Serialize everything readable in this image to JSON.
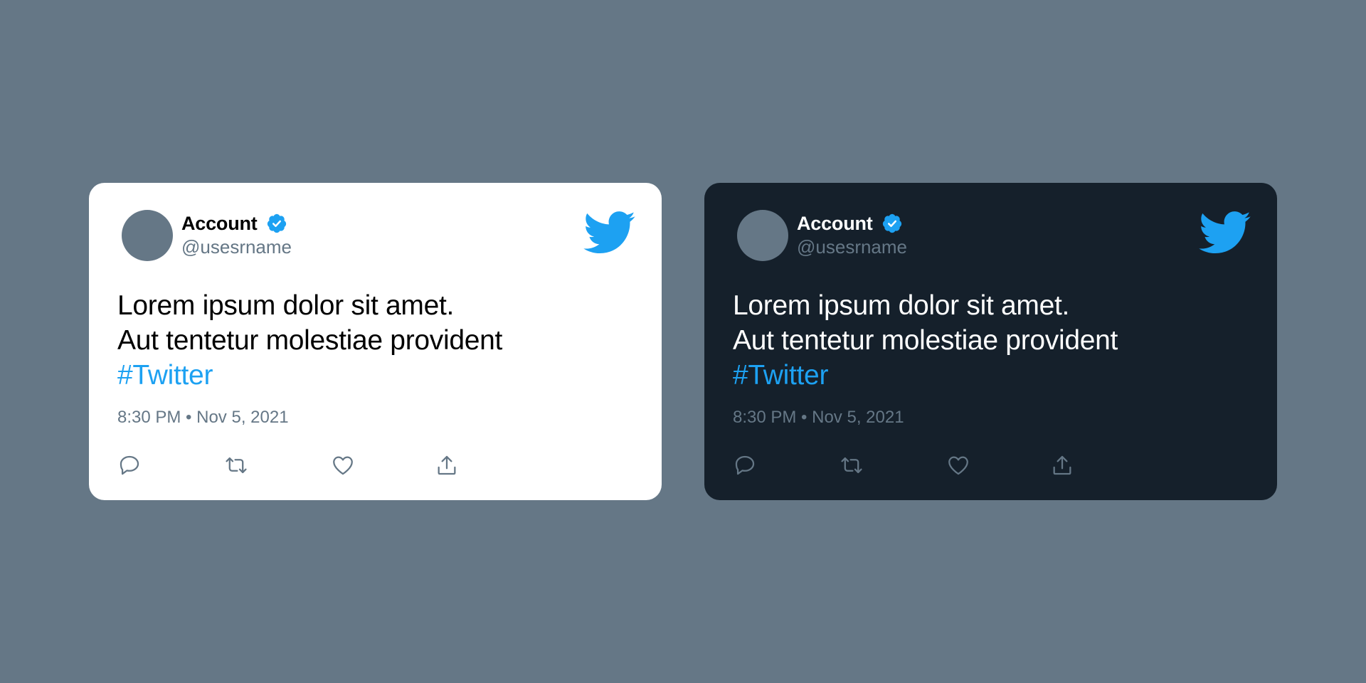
{
  "cards": [
    {
      "theme": "light",
      "account_name": "Account",
      "handle": "@usesrname",
      "text_lines": [
        "Lorem ipsum dolor sit amet.",
        "Aut tentetur molestiae provident"
      ],
      "hashtag": "#Twitter",
      "timestamp": "8:30 PM • Nov 5, 2021",
      "icons": [
        "verified-badge-icon",
        "twitter-bird-icon",
        "reply-icon",
        "retweet-icon",
        "like-icon",
        "share-icon"
      ]
    },
    {
      "theme": "dark",
      "account_name": "Account",
      "handle": "@usesrname",
      "text_lines": [
        "Lorem ipsum dolor sit amet.",
        "Aut tentetur molestiae provident"
      ],
      "hashtag": "#Twitter",
      "timestamp": "8:30 PM • Nov 5, 2021",
      "icons": [
        "verified-badge-icon",
        "twitter-bird-icon",
        "reply-icon",
        "retweet-icon",
        "like-icon",
        "share-icon"
      ]
    }
  ],
  "colors": {
    "page_background": "#657786",
    "light_card": "#ffffff",
    "dark_card": "#15202b",
    "accent": "#1da1f2",
    "secondary_text": "#657786"
  }
}
